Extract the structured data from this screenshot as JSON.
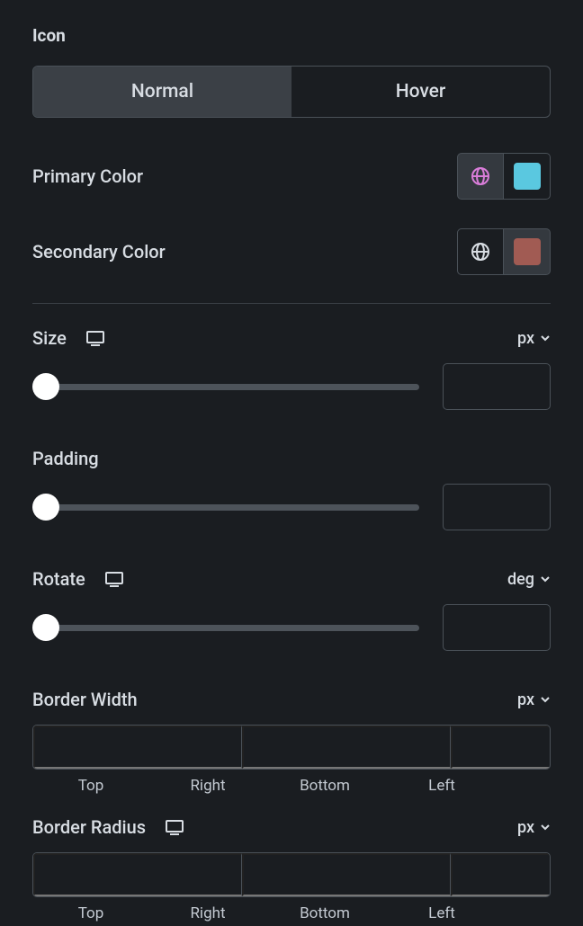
{
  "section": "Icon",
  "tabs": {
    "normal": "Normal",
    "hover": "Hover",
    "active": "normal"
  },
  "primary": {
    "label": "Primary Color",
    "globe_color": "#d97dd9",
    "swatch": "#5ac8e0"
  },
  "secondary": {
    "label": "Secondary Color",
    "globe_color": "#d8dde3",
    "swatch": "#a15b53"
  },
  "size": {
    "label": "Size",
    "unit": "px",
    "value": ""
  },
  "padding": {
    "label": "Padding",
    "value": ""
  },
  "rotate": {
    "label": "Rotate",
    "unit": "deg",
    "value": ""
  },
  "border_width": {
    "label": "Border Width",
    "unit": "px",
    "sides": {
      "top": "Top",
      "right": "Right",
      "bottom": "Bottom",
      "left": "Left"
    },
    "values": {
      "top": "",
      "right": "",
      "bottom": "",
      "left": ""
    }
  },
  "border_radius": {
    "label": "Border Radius",
    "unit": "px",
    "sides": {
      "top": "Top",
      "right": "Right",
      "bottom": "Bottom",
      "left": "Left"
    },
    "values": {
      "top": "",
      "right": "",
      "bottom": "",
      "left": ""
    }
  }
}
